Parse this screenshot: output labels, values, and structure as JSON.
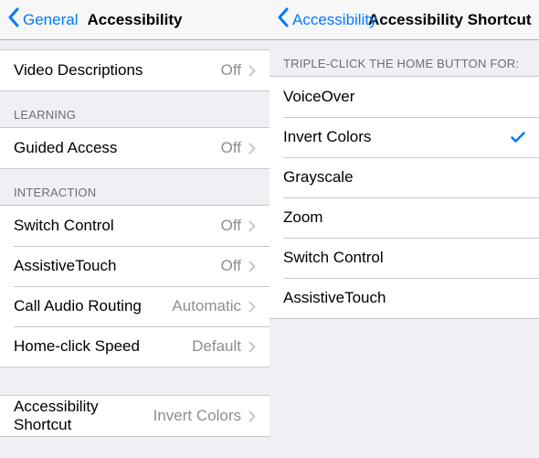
{
  "left": {
    "back_label": "General",
    "title": "Accessibility",
    "rows": {
      "video_descriptions": {
        "label": "Video Descriptions",
        "value": "Off"
      },
      "learning_header": "LEARNING",
      "guided_access": {
        "label": "Guided Access",
        "value": "Off"
      },
      "interaction_header": "INTERACTION",
      "switch_control": {
        "label": "Switch Control",
        "value": "Off"
      },
      "assistive_touch": {
        "label": "AssistiveTouch",
        "value": "Off"
      },
      "call_audio_routing": {
        "label": "Call Audio Routing",
        "value": "Automatic"
      },
      "home_click_speed": {
        "label": "Home-click Speed",
        "value": "Default"
      },
      "accessibility_shortcut": {
        "label": "Accessibility Shortcut",
        "value": "Invert Colors"
      }
    }
  },
  "right": {
    "back_label": "Accessibility",
    "title": "Accessibility Shortcut",
    "header": "TRIPLE-CLICK THE HOME BUTTON FOR:",
    "options": {
      "voiceover": {
        "label": "VoiceOver",
        "checked": false
      },
      "invert_colors": {
        "label": "Invert Colors",
        "checked": true
      },
      "grayscale": {
        "label": "Grayscale",
        "checked": false
      },
      "zoom": {
        "label": "Zoom",
        "checked": false
      },
      "switch_control": {
        "label": "Switch Control",
        "checked": false
      },
      "assistive_touch": {
        "label": "AssistiveTouch",
        "checked": false
      }
    }
  },
  "colors": {
    "accent": "#007aff"
  }
}
